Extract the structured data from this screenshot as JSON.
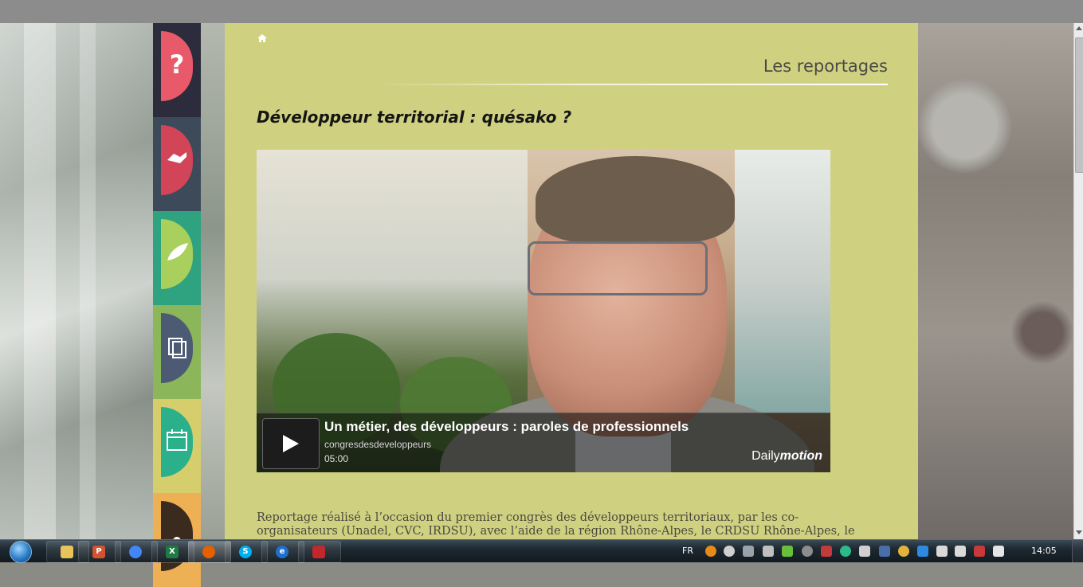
{
  "breadcrumb": {
    "home_icon": "home-icon"
  },
  "section": {
    "title": "Les reportages"
  },
  "article": {
    "title": "Développeur territorial : quésako ?",
    "body": "Reportage réalisé à l’occasion du premier congrès des développeurs territoriaux, par les co-organisateurs (Unadel, CVC, IRDSU), avec l’aide de la région Rhône-Alpes, le CRDSU Rhône-Alpes, le CRDR, le CIEDEL et"
  },
  "video": {
    "title": "Un métier, des développeurs : paroles de professionnels",
    "channel": "congresdesdeveloppeurs",
    "duration": "05:00",
    "brand_regular": "Daily",
    "brand_bold": "motion",
    "play_icon": "play-icon"
  },
  "sidenav": {
    "items": [
      {
        "icon": "question-icon",
        "color": "#e85a6a",
        "bg": "#2c2c3c"
      },
      {
        "icon": "handshake-icon",
        "color": "#d24457",
        "bg": "#3d4a5a"
      },
      {
        "icon": "leaf-icon",
        "color": "#a9cf5c",
        "bg": "#2fa27f"
      },
      {
        "icon": "documents-icon",
        "color": "#4d5a74",
        "bg": "#8bb65a"
      },
      {
        "icon": "calendar-icon",
        "color": "#2ab08b",
        "bg": "#d6cd6c"
      },
      {
        "icon": "people-icon",
        "color": "#3b2a1e",
        "bg": "#eeb055"
      }
    ]
  },
  "taskbar": {
    "start_icon": "windows-start-icon",
    "apps": [
      {
        "icon": "file-explorer-icon",
        "label": "",
        "color": "#e6c45a"
      },
      {
        "icon": "powerpoint-icon",
        "label": "P",
        "color": "#d35230"
      },
      {
        "icon": "chrome-icon",
        "label": "",
        "color": "#4285f4"
      },
      {
        "icon": "excel-icon",
        "label": "X",
        "color": "#1f7a44"
      },
      {
        "icon": "firefox-icon",
        "label": "",
        "color": "#e66000"
      },
      {
        "icon": "skype-icon",
        "label": "S",
        "color": "#00aff0"
      },
      {
        "icon": "internet-explorer-icon",
        "label": "e",
        "color": "#1f6fce"
      },
      {
        "icon": "acrobat-icon",
        "label": "",
        "color": "#c1272d"
      }
    ],
    "tray_lang": "FR",
    "clock": "14:05"
  }
}
